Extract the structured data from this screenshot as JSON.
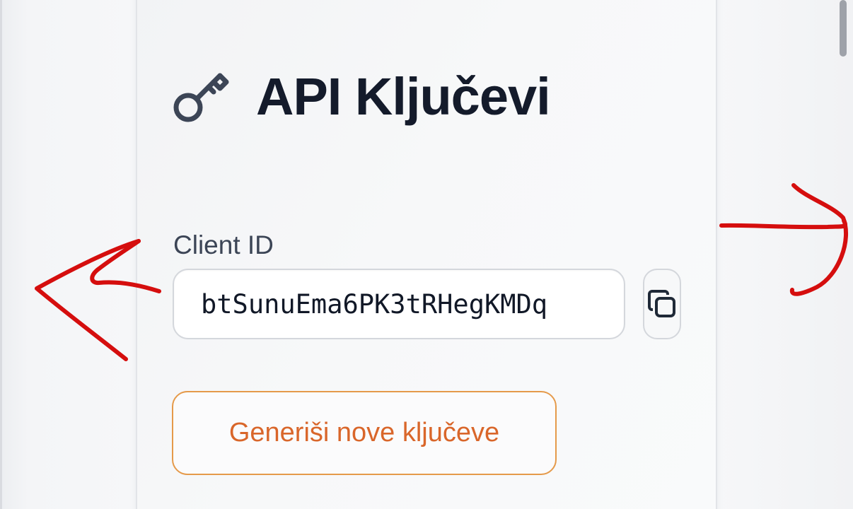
{
  "header": {
    "title": "API Ključevi",
    "icon": "key-icon"
  },
  "client_id": {
    "label": "Client ID",
    "value": "btSunuEma6PK3tRHegKMDq",
    "copy_icon": "copy-icon"
  },
  "actions": {
    "generate_label": "Generiši nove ključeve"
  },
  "annotations": {
    "arrow_color": "#d50e0e"
  },
  "colors": {
    "title_text": "#141b2b",
    "button_border": "#e59a4a",
    "button_text": "#d9662a",
    "icon": "#3c4556"
  }
}
